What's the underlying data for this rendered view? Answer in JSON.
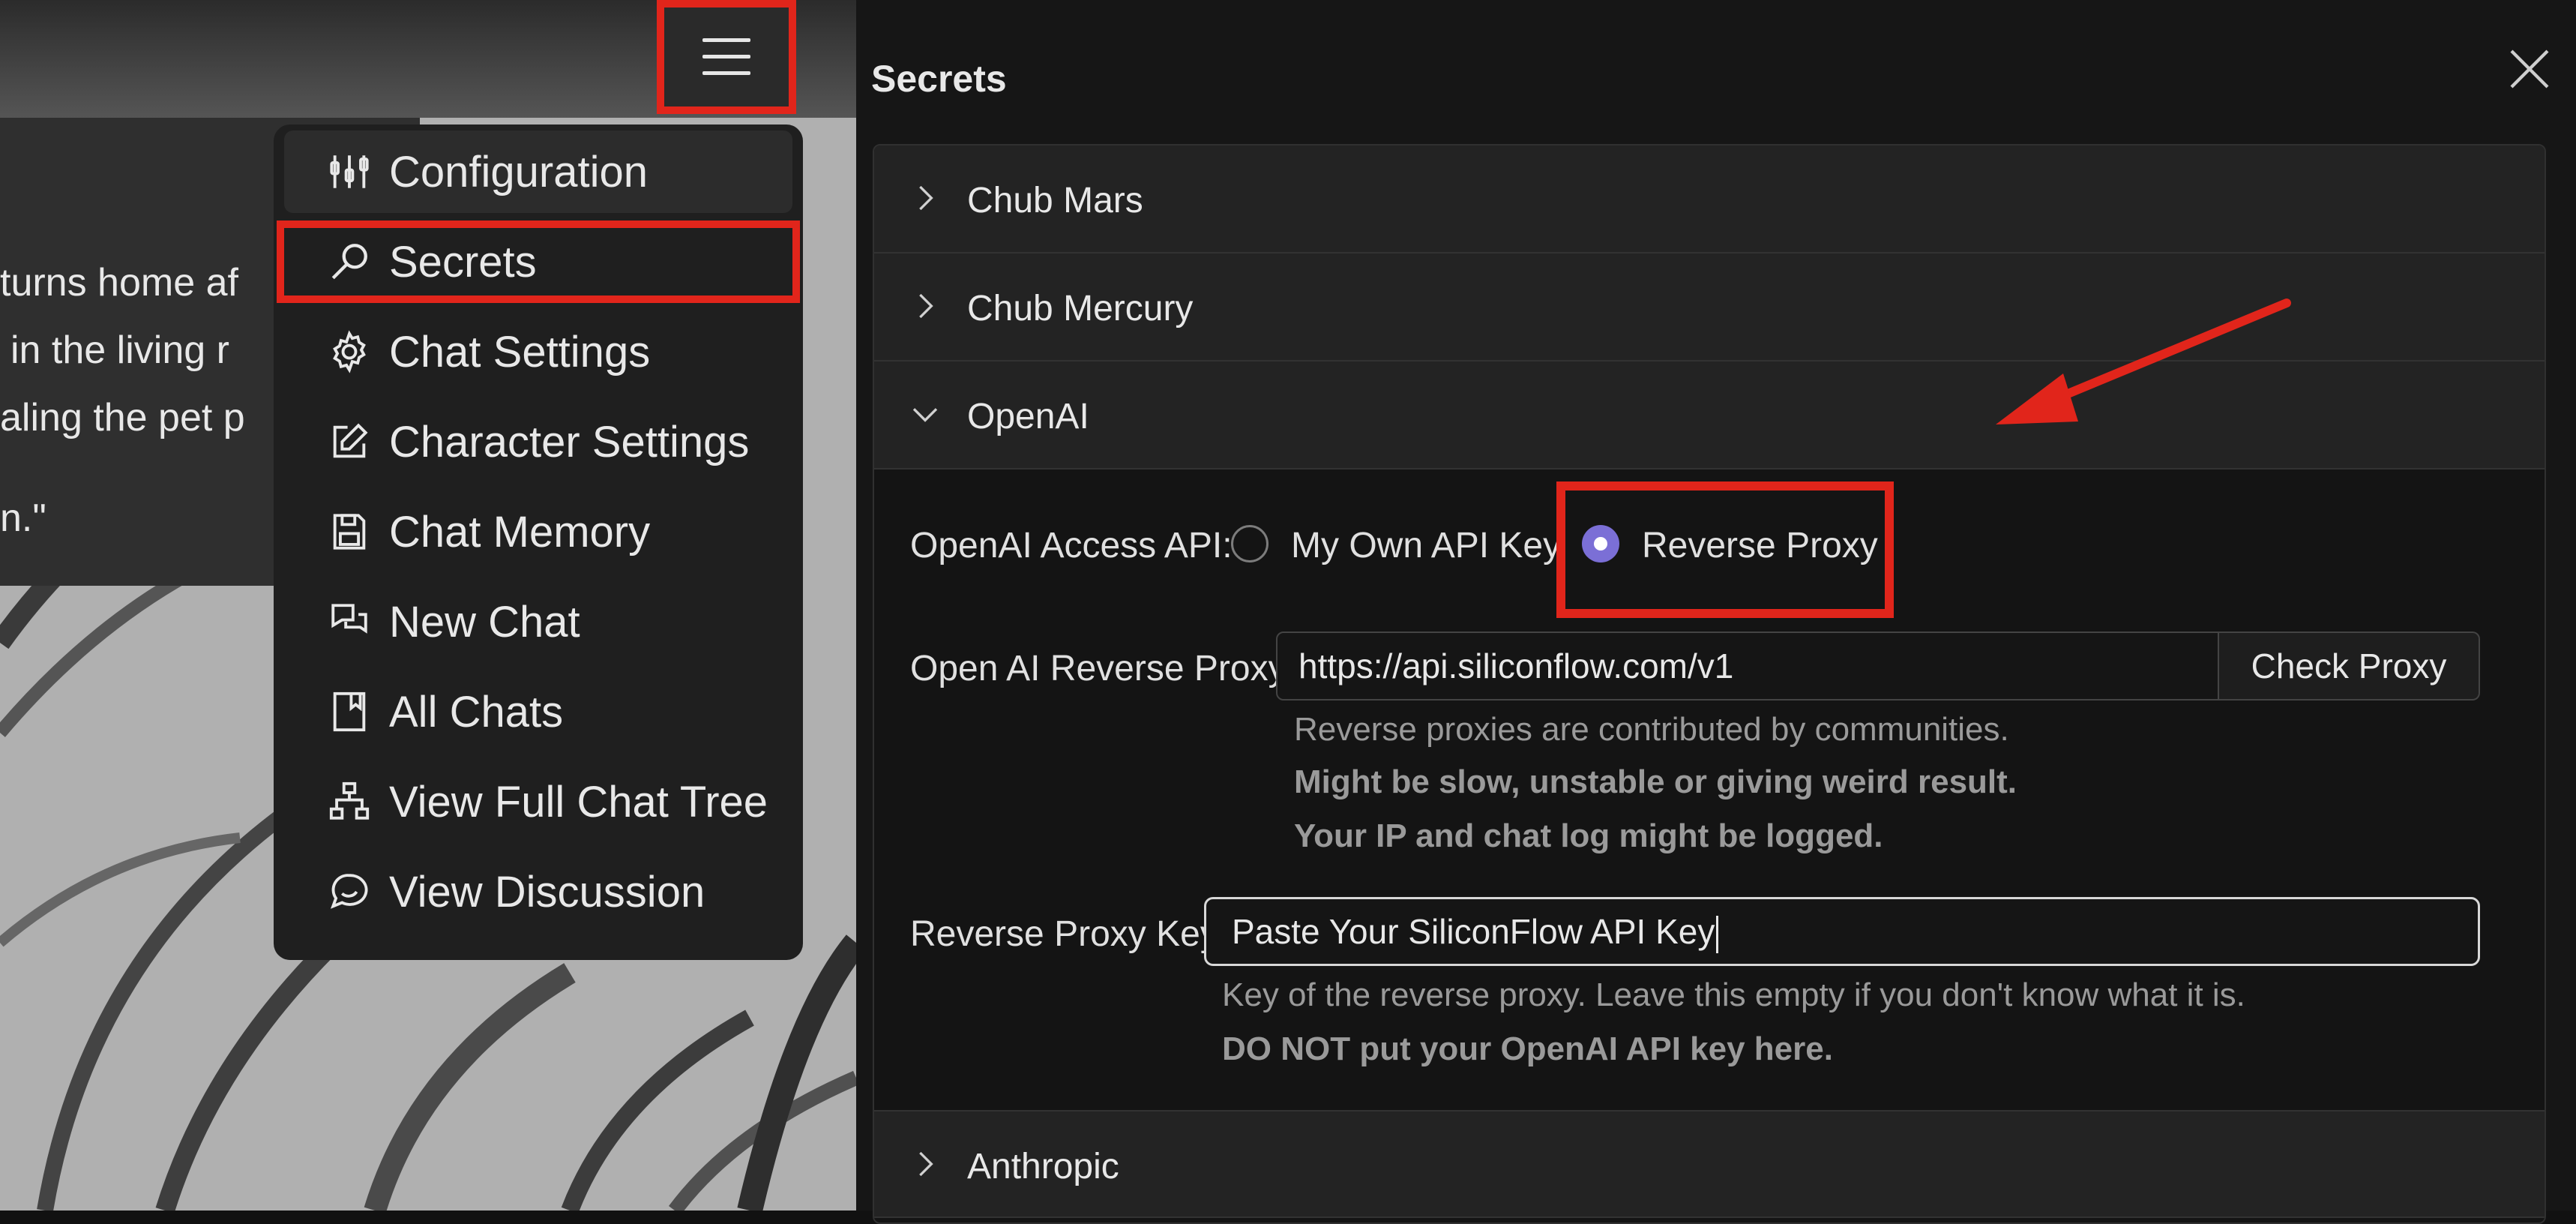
{
  "left": {
    "chat_lines": [
      "turns home af",
      "in the living r",
      "aling the pet p",
      "n.\""
    ],
    "menu": [
      {
        "label": "Configuration",
        "icon": "sliders-icon"
      },
      {
        "label": "Secrets",
        "icon": "key-icon"
      },
      {
        "label": "Chat Settings",
        "icon": "gear-icon"
      },
      {
        "label": "Character Settings",
        "icon": "edit-icon"
      },
      {
        "label": "Chat Memory",
        "icon": "save-icon"
      },
      {
        "label": "New Chat",
        "icon": "chat-bubbles-icon"
      },
      {
        "label": "All Chats",
        "icon": "bookmark-icon"
      },
      {
        "label": "View Full Chat Tree",
        "icon": "tree-icon"
      },
      {
        "label": "View Discussion",
        "icon": "discussion-icon"
      }
    ]
  },
  "panel": {
    "title": "Secrets",
    "sections": {
      "chub_mars": "Chub Mars",
      "chub_mercury": "Chub Mercury",
      "openai": "OpenAI",
      "anthropic": "Anthropic"
    },
    "openai": {
      "access_label": "OpenAI Access API:",
      "option_own": "My Own API Key",
      "option_proxy": "Reverse Proxy",
      "selected": "Reverse Proxy",
      "proxy_label": "Open AI Reverse Proxy:",
      "proxy_value": "https://api.siliconflow.com/v1",
      "check_proxy": "Check Proxy",
      "proxy_hint_1": "Reverse proxies are contributed by communities.",
      "proxy_hint_2": "Might be slow, unstable or giving weird result.",
      "proxy_hint_3": "Your IP and chat log might be logged.",
      "key_label": "Reverse Proxy Key:",
      "key_value": "Paste Your SiliconFlow API Key",
      "key_hint_1": "Key of the reverse proxy. Leave this empty if you don't know what it is.",
      "key_hint_2": "DO NOT put your OpenAI API key here."
    }
  },
  "colors": {
    "highlight": "#e1251b",
    "radio_accent": "#7b6fd6"
  }
}
